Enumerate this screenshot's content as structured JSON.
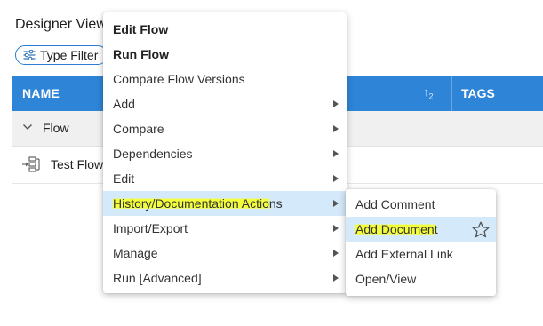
{
  "page": {
    "title": "Designer View",
    "filter_button_label": "Type Filter"
  },
  "grid": {
    "columns": [
      "NAME",
      "TAGS"
    ],
    "sort_indicator": "↑",
    "sort_index": "2",
    "group": {
      "label": "Flow"
    },
    "rows": [
      {
        "name": "Test Flow"
      }
    ]
  },
  "context_menu": {
    "items": [
      {
        "label": "Edit Flow",
        "bold": true,
        "has_submenu": false
      },
      {
        "label": "Run Flow",
        "bold": true,
        "has_submenu": false
      },
      {
        "label": "Compare Flow Versions",
        "bold": false,
        "has_submenu": false
      },
      {
        "label": "Add",
        "bold": false,
        "has_submenu": true
      },
      {
        "label": "Compare",
        "bold": false,
        "has_submenu": true
      },
      {
        "label": "Dependencies",
        "bold": false,
        "has_submenu": true
      },
      {
        "label": "Edit",
        "bold": false,
        "has_submenu": true
      },
      {
        "label": "History/Documentation Actions",
        "label_highlighted": "History/Documentation Actio",
        "label_rest": "ns",
        "bold": false,
        "has_submenu": true,
        "active": true
      },
      {
        "label": "Import/Export",
        "bold": false,
        "has_submenu": true
      },
      {
        "label": "Manage",
        "bold": false,
        "has_submenu": true
      },
      {
        "label": "Run [Advanced]",
        "bold": false,
        "has_submenu": true
      }
    ]
  },
  "submenu": {
    "items": [
      {
        "label": "Add Comment"
      },
      {
        "label": "Add Document",
        "label_highlighted": "Add Documen",
        "label_rest": "t",
        "active": true,
        "favorite_icon": "star-outline-icon"
      },
      {
        "label": "Add External Link"
      },
      {
        "label": "Open/View"
      }
    ]
  },
  "colors": {
    "header_bg": "#2e84d6",
    "active_item_bg": "#d4e9fa",
    "highlighter": "#f4ff3c",
    "filter_border": "#2b7ed1"
  }
}
